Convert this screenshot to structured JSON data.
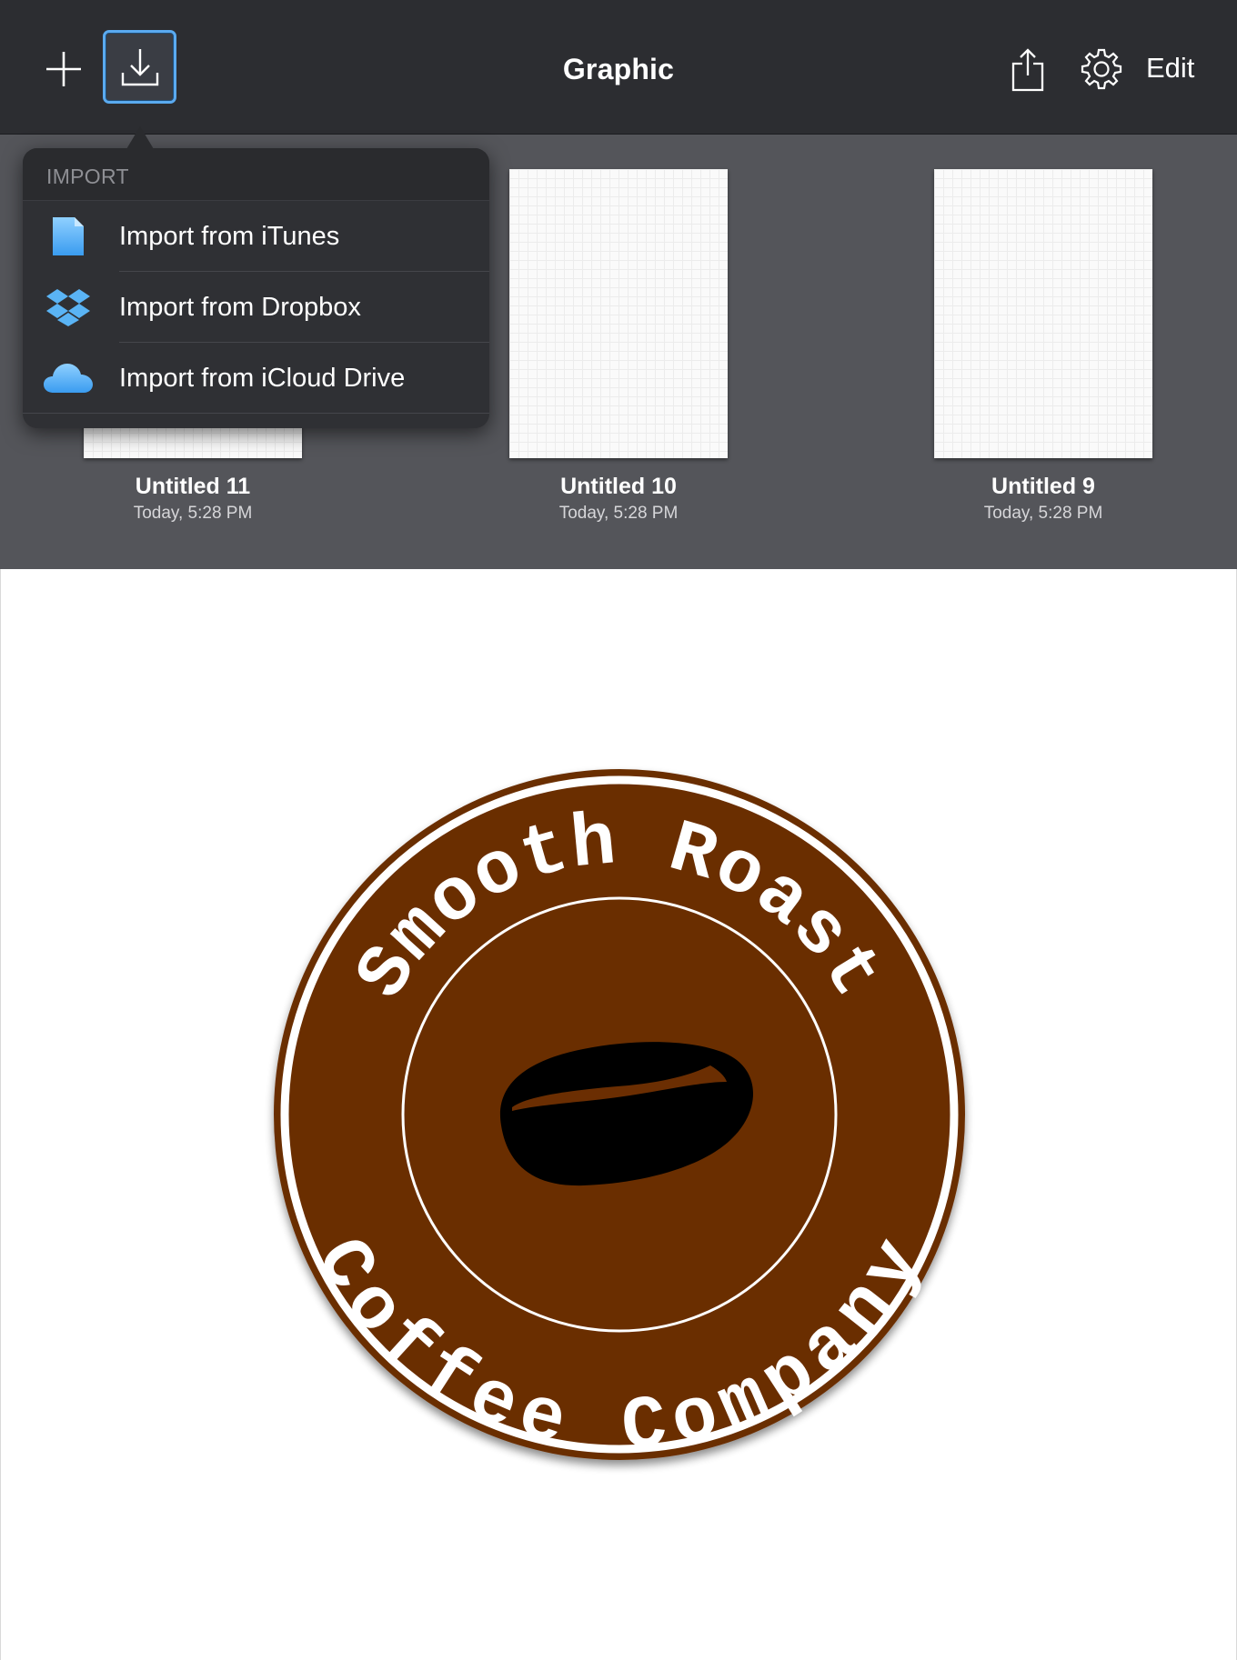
{
  "toolbar": {
    "title": "Graphic",
    "edit_label": "Edit",
    "icons": {
      "add": "plus-icon",
      "import": "download-tray-icon",
      "share": "share-icon",
      "settings": "gear-icon"
    },
    "accent_color": "#5aaaf0"
  },
  "import_menu": {
    "header": "IMPORT",
    "items": [
      {
        "label": "Import from iTunes",
        "icon": "document-icon"
      },
      {
        "label": "Import from Dropbox",
        "icon": "dropbox-icon"
      },
      {
        "label": "Import from iCloud Drive",
        "icon": "icloud-icon"
      }
    ]
  },
  "documents": [
    {
      "title": "Untitled 11",
      "date": "Today, 5:28 PM"
    },
    {
      "title": "Untitled 10",
      "date": "Today, 5:28 PM"
    },
    {
      "title": "Untitled 9",
      "date": "Today, 5:28 PM"
    }
  ],
  "logo": {
    "top_text": "Smooth Roast",
    "bottom_text": "Coffee Company",
    "badge_color": "#6b2e02",
    "icon": "coffee-bean-icon"
  }
}
